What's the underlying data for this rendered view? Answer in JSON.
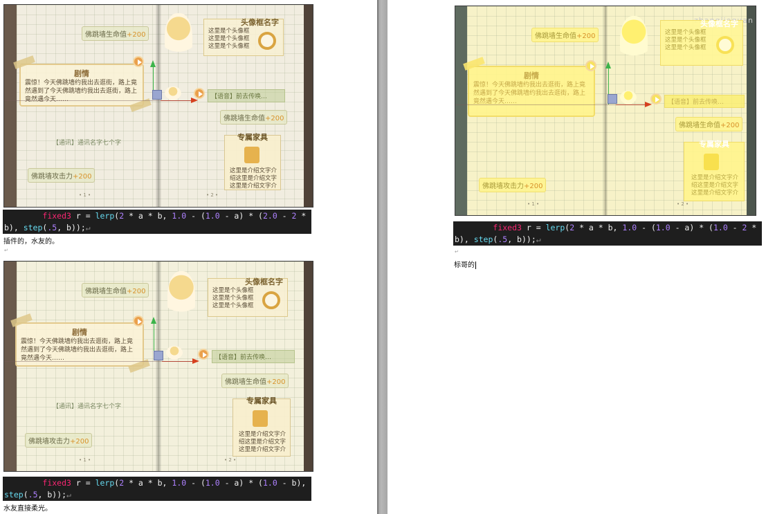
{
  "book": {
    "stat_hp": "佛跳墙生命值",
    "stat_plus": "+200",
    "stat_atk": "佛跳墙攻击力",
    "story_title": "剧情",
    "story_text": "震惊！今天佛跳墙约我出去逛街，路上竟然遇到了今天佛跳墙约我出去逛街，路上竟然遇今天……",
    "avatar_title": "头像框名字",
    "avatar_text": [
      "这里是个头像框",
      "这里是个头像框",
      "这里是个头像框"
    ],
    "dialog_bar": "【语音】前去传唤…",
    "phone_text": "【通讯】通讯名字七个字",
    "furn_title": "专属家具",
    "furn_text": [
      "这里是介绍文字介",
      "绍这里是介绍文字",
      "这里是介绍文字介"
    ],
    "page_left": "• 1 •",
    "page_right": "• 2 •"
  },
  "blocks": [
    {
      "code_indent": "        ",
      "kw": "fixed3",
      "p1": " r = ",
      "fn1": "lerp",
      "p2": "(",
      "n1": "2",
      "p3": " * a * b, ",
      "n2": "1.0",
      "p4": " - (",
      "n3": "1.0",
      "p5": " - a) * (",
      "n4": "2.0",
      "p6": " - ",
      "n5": "2",
      "p7": " * b), ",
      "fn2": "step",
      "p8": "(",
      "n6": ".5",
      "p9": ", b));",
      "mark": "↵",
      "caption": "插件的，水友的。"
    },
    {
      "code_indent": "        ",
      "kw": "fixed3",
      "p1": " r = ",
      "fn1": "lerp",
      "p2": "(",
      "n1": "2",
      "p3": " * a * b, ",
      "n2": "1.0",
      "p4": " - (",
      "n3": "1.0",
      "p5": " - a) * (",
      "n4": "1.0",
      "p6": " - b)",
      "p7": ", ",
      "fn2": "step",
      "p8": "(",
      "n6": ".5",
      "p9": ", b));",
      "mark": "↵",
      "caption": "水友直接柔光。"
    },
    {
      "code_indent": "        ",
      "kw": "fixed3",
      "p1": " r = ",
      "fn1": "lerp",
      "p2": "(",
      "n1": "2",
      "p3": " * a * b, ",
      "n2": "1.0",
      "p4": " - (",
      "n3": "1.0",
      "p5": " - a) * (",
      "n4": "1.0",
      "p6": " - ",
      "n5": "2",
      "p7": " * b), ",
      "fn2": "step",
      "p8": "(",
      "n6": ".5",
      "p9": ", b));",
      "mark": "↵",
      "caption": "标哥的",
      "watermark": "zhangjiequan"
    }
  ],
  "para_mark": "↵"
}
